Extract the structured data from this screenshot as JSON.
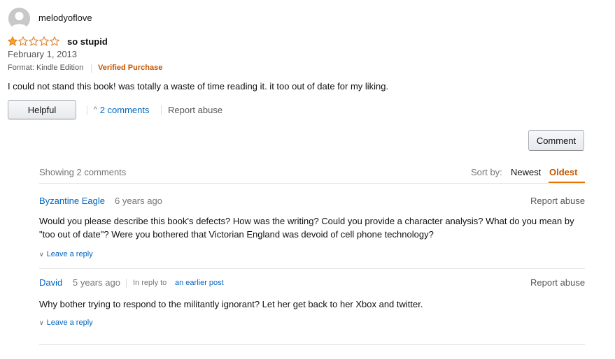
{
  "review": {
    "reviewer_name": "melodyoflove",
    "rating": 1,
    "max_rating": 5,
    "title": "so stupid",
    "date": "February 1, 2013",
    "format": "Format: Kindle Edition",
    "verified": "Verified Purchase",
    "body": "I could not stand this book! was totally a waste of time reading it. it too out of date for my liking.",
    "helpful_label": "Helpful",
    "comments_link": "2 comments",
    "report_abuse": "Report abuse"
  },
  "comments_section": {
    "comment_button": "Comment",
    "showing": "Showing 2 comments",
    "sort_label": "Sort by:",
    "sort_newest": "Newest",
    "sort_oldest": "Oldest",
    "comments": [
      {
        "author": "Byzantine Eagle",
        "time": "6 years ago",
        "report": "Report abuse",
        "text_line1": "Would you please describe this book's defects? How was the writing? Could you provide a character analysis? What do you mean by",
        "text_line2": "\"too out of date\"? Were you bothered that Victorian England was devoid of cell phone technology?",
        "reply_label": "Leave a reply"
      },
      {
        "author": "David",
        "time": "5 years ago",
        "in_reply_to": "In reply to",
        "earlier_post": "an earlier post",
        "report": "Report abuse",
        "text_line1": "Why bother trying to respond to the militantly ignorant? Let her get back to her Xbox and twitter.",
        "reply_label": "Leave a reply"
      }
    ]
  },
  "colors": {
    "link": "#0066c0",
    "verified": "#c45500",
    "star_fill": "#ffa41c",
    "star_outline": "#de7921"
  }
}
